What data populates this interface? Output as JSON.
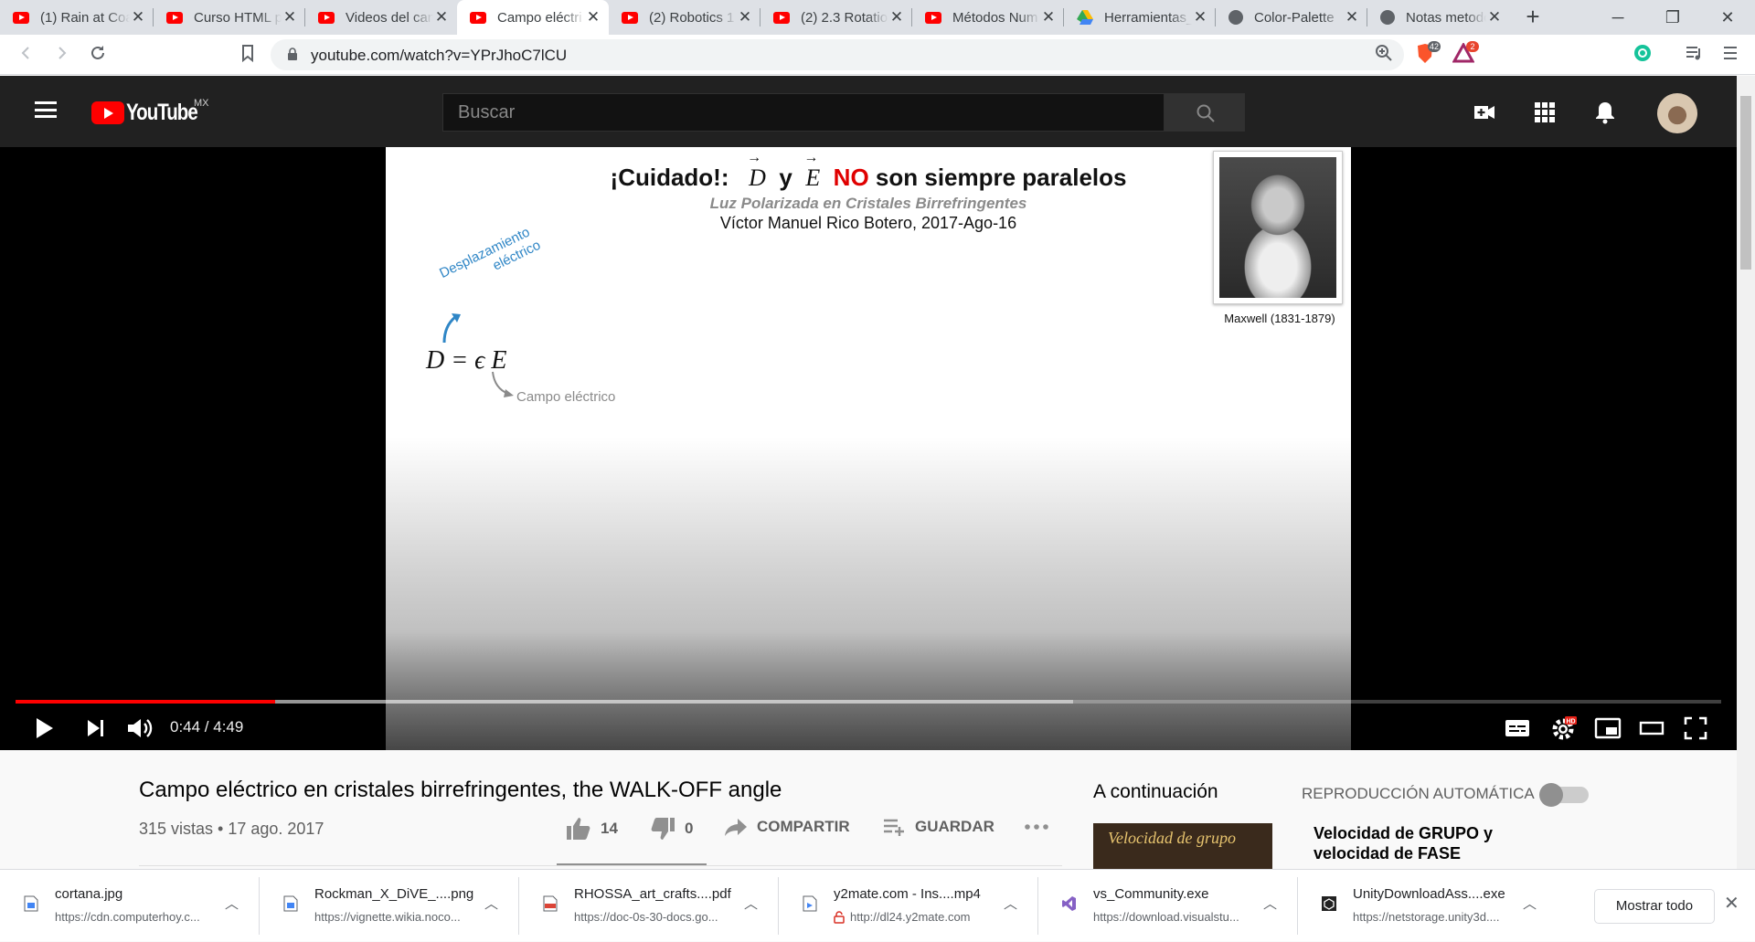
{
  "browser": {
    "tabs": [
      {
        "title": "(1) Rain at Coa",
        "icon": "youtube-icon",
        "active": false
      },
      {
        "title": "Curso HTML p",
        "icon": "youtube-icon",
        "active": false
      },
      {
        "title": "Videos del can",
        "icon": "youtube-icon",
        "active": false
      },
      {
        "title": "Campo eléctri",
        "icon": "youtube-icon",
        "active": true
      },
      {
        "title": "(2) Robotics 1",
        "icon": "youtube-icon",
        "active": false
      },
      {
        "title": "(2) 2.3 Rotatio",
        "icon": "youtube-icon",
        "active": false
      },
      {
        "title": "Métodos Num",
        "icon": "youtube-icon",
        "active": false
      },
      {
        "title": "Herramientas_",
        "icon": "drive-icon",
        "active": false
      },
      {
        "title": "Color-Palette",
        "icon": "globe-icon",
        "active": false
      },
      {
        "title": "Notas metodo",
        "icon": "globe-icon",
        "active": false
      }
    ],
    "url": "youtube.com/watch?v=YPrJhoC7lCU",
    "brave_badge": "42",
    "rewards_badge": "2"
  },
  "youtube": {
    "logo_text": "YouTube",
    "region": "MX",
    "search_placeholder": "Buscar"
  },
  "slide": {
    "title_prefix": "¡Cuidado!:",
    "vec_d": "D",
    "word_y": "y",
    "vec_e": "E",
    "word_no": "NO",
    "title_suffix": "son siempre paralelos",
    "subtitle": "Luz Polarizada en Cristales Birrefringentes",
    "author": "Víctor Manuel Rico Botero, 2017-Ago-16",
    "portrait_caption": "Maxwell (1831-1879)",
    "equation": "D = ϵ E",
    "annotation_displacement_1": "Desplazamiento",
    "annotation_displacement_2": "eléctrico",
    "annotation_field": "Campo eléctrico"
  },
  "player": {
    "time": "0:44 / 4:49",
    "played_fraction": 0.152,
    "buffered_fraction": 0.62
  },
  "video": {
    "title": "Campo eléctrico en cristales birrefringentes, the WALK-OFF angle",
    "meta": "315 vistas • 17 ago. 2017",
    "likes": "14",
    "dislikes": "0",
    "share_label": "COMPARTIR",
    "save_label": "GUARDAR"
  },
  "sidebar": {
    "heading": "A continuación",
    "autoplay_label": "REPRODUCCIÓN AUTOMÁTICA",
    "next_thumb_text": "Velocidad de grupo",
    "next_title": "Velocidad de GRUPO y velocidad de FASE"
  },
  "downloads": [
    {
      "name": "cortana.jpg",
      "source": "https://cdn.computerhoy.c...",
      "icon": "image-file-icon"
    },
    {
      "name": "Rockman_X_DiVE_....png",
      "source": "https://vignette.wikia.noco...",
      "icon": "image-file-icon"
    },
    {
      "name": "RHOSSA_art_crafts....pdf",
      "source": "https://doc-0s-30-docs.go...",
      "icon": "pdf-file-icon"
    },
    {
      "name": "y2mate.com - Ins....mp4",
      "source": "http://dl24.y2mate.com",
      "icon": "video-file-icon"
    },
    {
      "name": "vs_Community.exe",
      "source": "https://download.visualstu...",
      "icon": "visual-studio-icon"
    },
    {
      "name": "UnityDownloadAss....exe",
      "source": "https://netstorage.unity3d....",
      "icon": "unity-icon"
    }
  ],
  "show_all_label": "Mostrar todo"
}
